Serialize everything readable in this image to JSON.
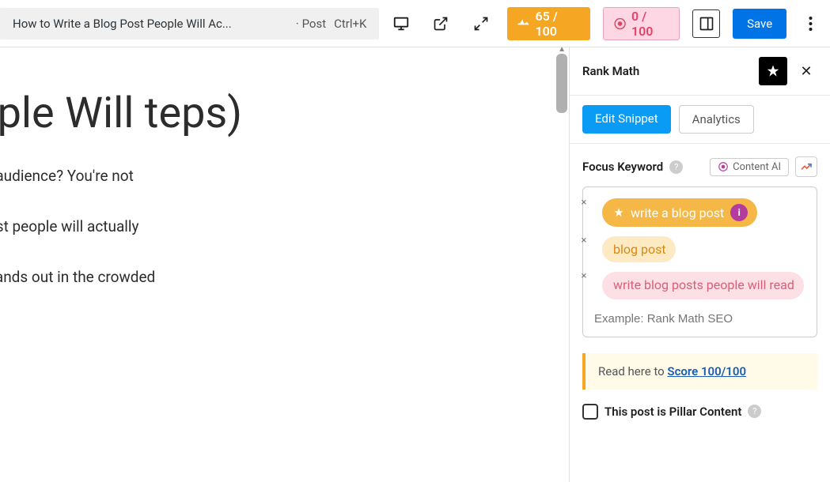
{
  "topbar": {
    "title": "How to Write a Blog Post People Will Ac...",
    "type_sep": " · ",
    "type": "Post",
    "shortcut": "Ctrl+K",
    "score1": "65 / 100",
    "score2": "0 / 100",
    "save": "Save"
  },
  "editor": {
    "heading": "Post People Will teps)",
    "p1": "ate content that'll captivate your audience? You're not",
    "p2": "discovered that writing a blog post people will actually",
    "p3": "aft an engaging blog post that stands out in the crowded"
  },
  "sidebar": {
    "title": "Rank Math",
    "tab_edit": "Edit Snippet",
    "tab_analytics": "Analytics",
    "focus_label": "Focus Keyword",
    "content_ai": "Content AI",
    "keywords": {
      "k1": "write a blog post",
      "k2": "blog post",
      "k3": "write blog posts people will read",
      "placeholder": "Example: Rank Math SEO"
    },
    "tip_pre": "Read here to ",
    "tip_link": "Score 100/100",
    "pillar": "This post is Pillar Content"
  }
}
